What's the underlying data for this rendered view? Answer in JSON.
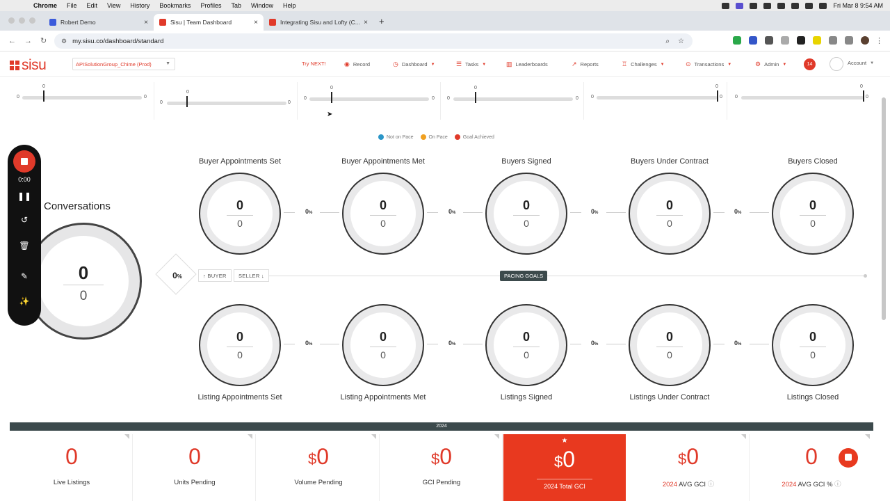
{
  "menubar": {
    "app": "Chrome",
    "items": [
      "File",
      "Edit",
      "View",
      "History",
      "Bookmarks",
      "Profiles",
      "Tab",
      "Window",
      "Help"
    ],
    "clock": "Fri Mar 8  9:54 AM"
  },
  "tabs": [
    {
      "title": "Robert Demo",
      "fav_color": "#3b5bdb"
    },
    {
      "title": "Sisu | Team Dashboard",
      "fav_color": "#e03a2a"
    },
    {
      "title": "Integrating Sisu and Lofty (C...",
      "fav_color": "#e03a2a"
    }
  ],
  "address": {
    "url": "my.sisu.co/dashboard/standard"
  },
  "header": {
    "logo": "sisu",
    "team": "APISolutionGroup_Chime (Prod)",
    "try_next": "Try NEXT!",
    "nav": [
      {
        "label": "Record",
        "icon": "record-icon"
      },
      {
        "label": "Dashboard",
        "icon": "dashboard-icon",
        "caret": true
      },
      {
        "label": "Tasks",
        "icon": "tasks-icon",
        "caret": true
      },
      {
        "label": "Leaderboards",
        "icon": "leaderboard-icon"
      },
      {
        "label": "Reports",
        "icon": "reports-icon"
      },
      {
        "label": "Challenges",
        "icon": "trophy-icon",
        "caret": true
      },
      {
        "label": "Transactions",
        "icon": "transactions-icon",
        "caret": true
      },
      {
        "label": "Admin",
        "icon": "gear-icon",
        "caret": true
      }
    ],
    "notifications": "14",
    "account": "Account"
  },
  "progress_row": [
    {
      "left": "0",
      "right": "0",
      "top": "0",
      "fill": 0
    },
    {
      "left": "0",
      "right": "0",
      "top": "0",
      "fill": 0
    },
    {
      "left": "0",
      "right": "0",
      "top": "0",
      "fill": 0
    },
    {
      "left": "0",
      "right": "0",
      "top": "0",
      "fill": 0
    },
    {
      "left": "0",
      "right": "0",
      "top": "0",
      "fill": 1
    },
    {
      "left": "0",
      "right": "0",
      "top": "0",
      "fill": 1
    }
  ],
  "legend": [
    {
      "label": "Not on Pace",
      "color": "#2b96c8"
    },
    {
      "label": "On Pace",
      "color": "#f0a020"
    },
    {
      "label": "Goal Achieved",
      "color": "#e03a2a"
    }
  ],
  "recorder": {
    "time": "0:00"
  },
  "conversations": {
    "title": "Conversations",
    "value": "0",
    "goal": "0",
    "pct": "0",
    "pct_unit": "%"
  },
  "toggle": {
    "buyer": "↑ BUYER",
    "seller": "SELLER ↓"
  },
  "pacing_label": "PACING GOALS",
  "buyer_row": [
    {
      "title": "Buyer Appointments Set",
      "value": "0",
      "goal": "0"
    },
    {
      "title": "Buyer Appointments Met",
      "value": "0",
      "goal": "0"
    },
    {
      "title": "Buyers Signed",
      "value": "0",
      "goal": "0"
    },
    {
      "title": "Buyers Under Contract",
      "value": "0",
      "goal": "0"
    },
    {
      "title": "Buyers Closed",
      "value": "0",
      "goal": "0"
    }
  ],
  "seller_row": [
    {
      "title": "Listing Appointments Set",
      "value": "0",
      "goal": "0"
    },
    {
      "title": "Listing Appointments Met",
      "value": "0",
      "goal": "0"
    },
    {
      "title": "Listings Signed",
      "value": "0",
      "goal": "0"
    },
    {
      "title": "Listings Under Contract",
      "value": "0",
      "goal": "0"
    },
    {
      "title": "Listings Closed",
      "value": "0",
      "goal": "0"
    }
  ],
  "conversion_pct": {
    "value": "0",
    "unit": "%"
  },
  "year": "2024",
  "stats": [
    {
      "value": "0",
      "prefix": "",
      "label": "Live Listings"
    },
    {
      "value": "0",
      "prefix": "",
      "label": "Units Pending"
    },
    {
      "value": "0",
      "prefix": "$",
      "label": "Volume Pending"
    },
    {
      "value": "0",
      "prefix": "$",
      "label": "GCI Pending"
    },
    {
      "value": "0",
      "prefix": "$",
      "label": "2024 Total GCI",
      "highlight": true
    },
    {
      "value": "0",
      "prefix": "$",
      "label_year": "2024",
      "label": " AVG GCI"
    },
    {
      "value": "0",
      "prefix": "",
      "label_year": "2024",
      "label": " AVG GCI %"
    }
  ],
  "colors": {
    "brand": "#e03a2a",
    "dark": "#3c4a4c"
  }
}
